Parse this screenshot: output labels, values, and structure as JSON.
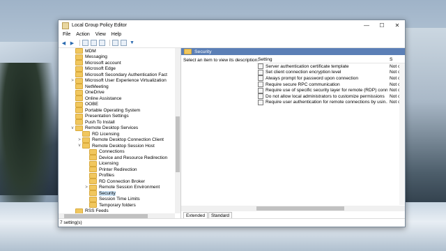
{
  "window": {
    "title": "Local Group Policy Editor",
    "controls": {
      "minimize": "—",
      "maximize": "☐",
      "close": "✕"
    }
  },
  "menu": [
    "File",
    "Action",
    "View",
    "Help"
  ],
  "tree": {
    "items": [
      {
        "label": "MDM",
        "level": 1,
        "caret": ""
      },
      {
        "label": "Messaging",
        "level": 1,
        "caret": ""
      },
      {
        "label": "Microsoft account",
        "level": 1,
        "caret": ""
      },
      {
        "label": "Microsoft Edge",
        "level": 1,
        "caret": ""
      },
      {
        "label": "Microsoft Secondary Authentication Fact",
        "level": 1,
        "caret": ""
      },
      {
        "label": "Microsoft User Experience Virtualization",
        "level": 1,
        "caret": ">"
      },
      {
        "label": "NetMeeting",
        "level": 1,
        "caret": ""
      },
      {
        "label": "OneDrive",
        "level": 1,
        "caret": ""
      },
      {
        "label": "Online Assistance",
        "level": 1,
        "caret": ""
      },
      {
        "label": "OOBE",
        "level": 1,
        "caret": ""
      },
      {
        "label": "Portable Operating System",
        "level": 1,
        "caret": ""
      },
      {
        "label": "Presentation Settings",
        "level": 1,
        "caret": ""
      },
      {
        "label": "Push To Install",
        "level": 1,
        "caret": ""
      },
      {
        "label": "Remote Desktop Services",
        "level": 1,
        "caret": "v"
      },
      {
        "label": "RD Licensing",
        "level": 2,
        "caret": ""
      },
      {
        "label": "Remote Desktop Connection Client",
        "level": 2,
        "caret": ">"
      },
      {
        "label": "Remote Desktop Session Host",
        "level": 2,
        "caret": "v"
      },
      {
        "label": "Connections",
        "level": 3,
        "caret": ""
      },
      {
        "label": "Device and Resource Redirection",
        "level": 3,
        "caret": ""
      },
      {
        "label": "Licensing",
        "level": 3,
        "caret": ""
      },
      {
        "label": "Printer Redirection",
        "level": 3,
        "caret": ""
      },
      {
        "label": "Profiles",
        "level": 3,
        "caret": ""
      },
      {
        "label": "RD Connection Broker",
        "level": 3,
        "caret": ""
      },
      {
        "label": "Remote Session Environment",
        "level": 3,
        "caret": ">"
      },
      {
        "label": "Security",
        "level": 3,
        "caret": "",
        "selected": true
      },
      {
        "label": "Session Time Limits",
        "level": 3,
        "caret": ""
      },
      {
        "label": "Temporary folders",
        "level": 3,
        "caret": ""
      },
      {
        "label": "RSS Feeds",
        "level": 1,
        "caret": ""
      }
    ]
  },
  "right": {
    "header": "Security",
    "description": "Select an item to view its description.",
    "columns": {
      "setting": "Setting",
      "state": "S"
    },
    "rows": [
      {
        "setting": "Server authentication certificate template",
        "state": "Not c"
      },
      {
        "setting": "Set client connection encryption level",
        "state": "Not c"
      },
      {
        "setting": "Always prompt for password upon connection",
        "state": "Not c"
      },
      {
        "setting": "Require secure RPC communication",
        "state": "Not c"
      },
      {
        "setting": "Require use of specific security layer for remote (RDP) conn...",
        "state": "Not c"
      },
      {
        "setting": "Do not allow local administrators to customize permissions",
        "state": "Not c"
      },
      {
        "setting": "Require user authentication for remote connections by usin...",
        "state": "Not c"
      }
    ],
    "tabs": [
      "Extended",
      "Standard"
    ]
  },
  "status": "7 setting(s)"
}
